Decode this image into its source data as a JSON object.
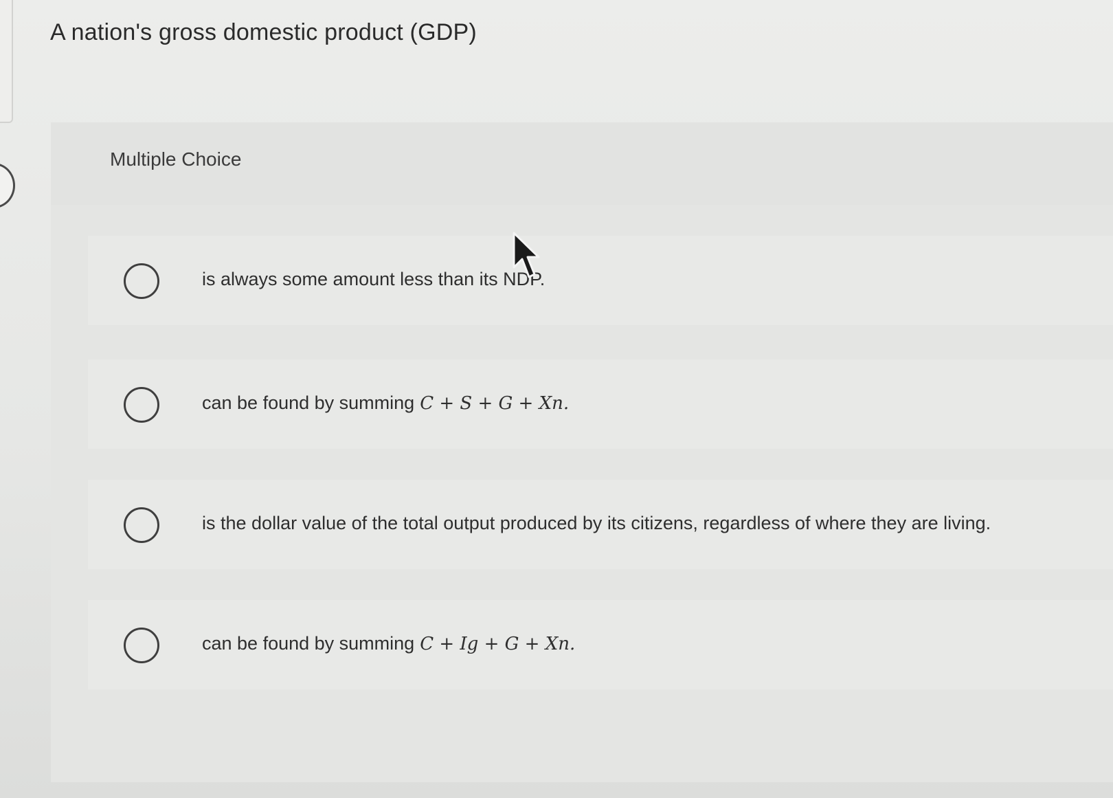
{
  "question": {
    "text": "A nation's gross domestic product (GDP)"
  },
  "multiple_choice": {
    "label": "Multiple Choice",
    "options": [
      {
        "text": "is always some amount less than its NDP.",
        "formula": ""
      },
      {
        "text": "can be found by summing",
        "formula": "C + S + G + Xn."
      },
      {
        "text": "is the dollar value of the total output produced by its citizens, regardless of where they are living.",
        "formula": ""
      },
      {
        "text": "can be found by summing",
        "formula": "C + Ig + G + Xn."
      }
    ]
  },
  "icons": {
    "cursor": "mouse-pointer-icon",
    "radio": "radio-button-icon",
    "nav": "nav-circle-icon"
  },
  "colors": {
    "background": "#e6e7e5",
    "panel": "#e4e5e3",
    "text": "#2b2b2b",
    "radio_border": "#3f3f3f"
  }
}
